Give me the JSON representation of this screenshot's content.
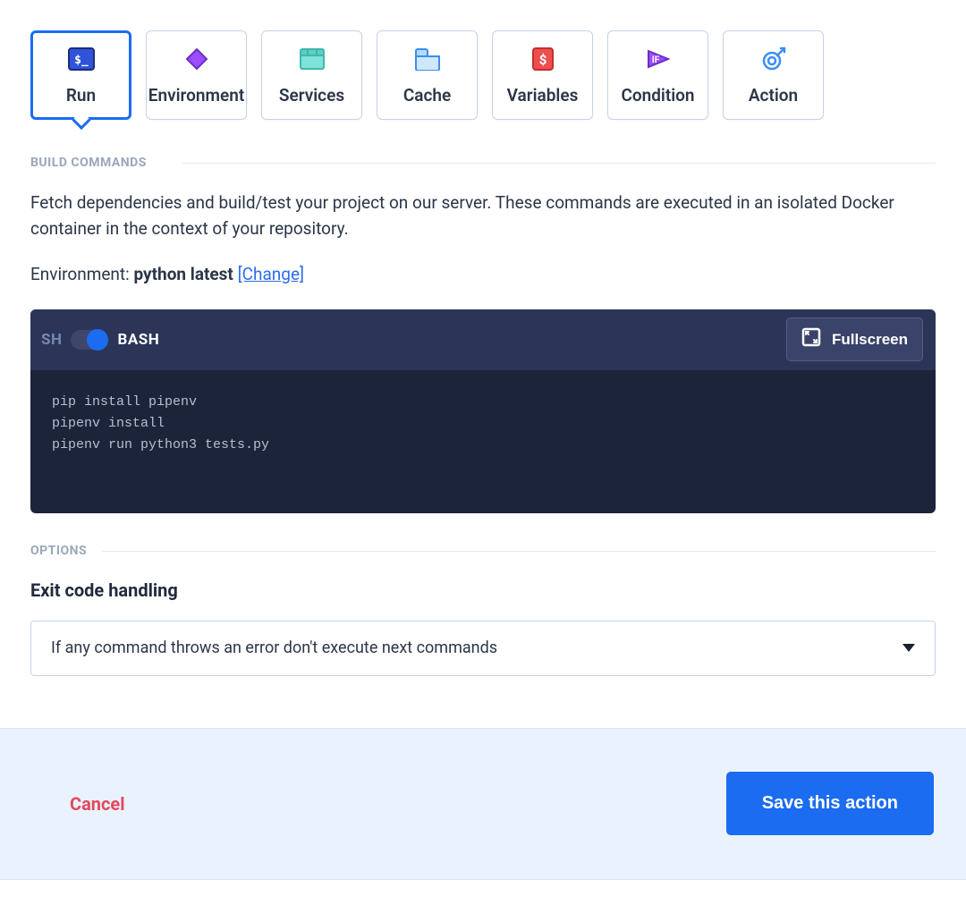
{
  "tabs": [
    {
      "key": "run",
      "label": "Run",
      "active": true
    },
    {
      "key": "environment",
      "label": "Environment",
      "active": false
    },
    {
      "key": "services",
      "label": "Services",
      "active": false
    },
    {
      "key": "cache",
      "label": "Cache",
      "active": false
    },
    {
      "key": "variables",
      "label": "Variables",
      "active": false
    },
    {
      "key": "condition",
      "label": "Condition",
      "active": false
    },
    {
      "key": "action",
      "label": "Action",
      "active": false
    }
  ],
  "build": {
    "section_title": "BUILD COMMANDS",
    "description": "Fetch dependencies and build/test your project on our server. These commands are executed in an isolated Docker container in the context of your repository.",
    "env_prefix": "Environment: ",
    "env_value": "python latest",
    "change_label": "[Change]"
  },
  "editor": {
    "sh_label": "SH",
    "bash_label": "BASH",
    "shell_mode": "BASH",
    "fullscreen_label": "Fullscreen",
    "code": "pip install pipenv\npipenv install\npipenv run python3 tests.py"
  },
  "options": {
    "section_title": "OPTIONS",
    "exit_label": "Exit code handling",
    "exit_value": "If any command throws an error don't execute next commands"
  },
  "footer": {
    "cancel": "Cancel",
    "save": "Save this action"
  },
  "colors": {
    "accent": "#1b6cf0",
    "danger": "#e24a5b"
  }
}
